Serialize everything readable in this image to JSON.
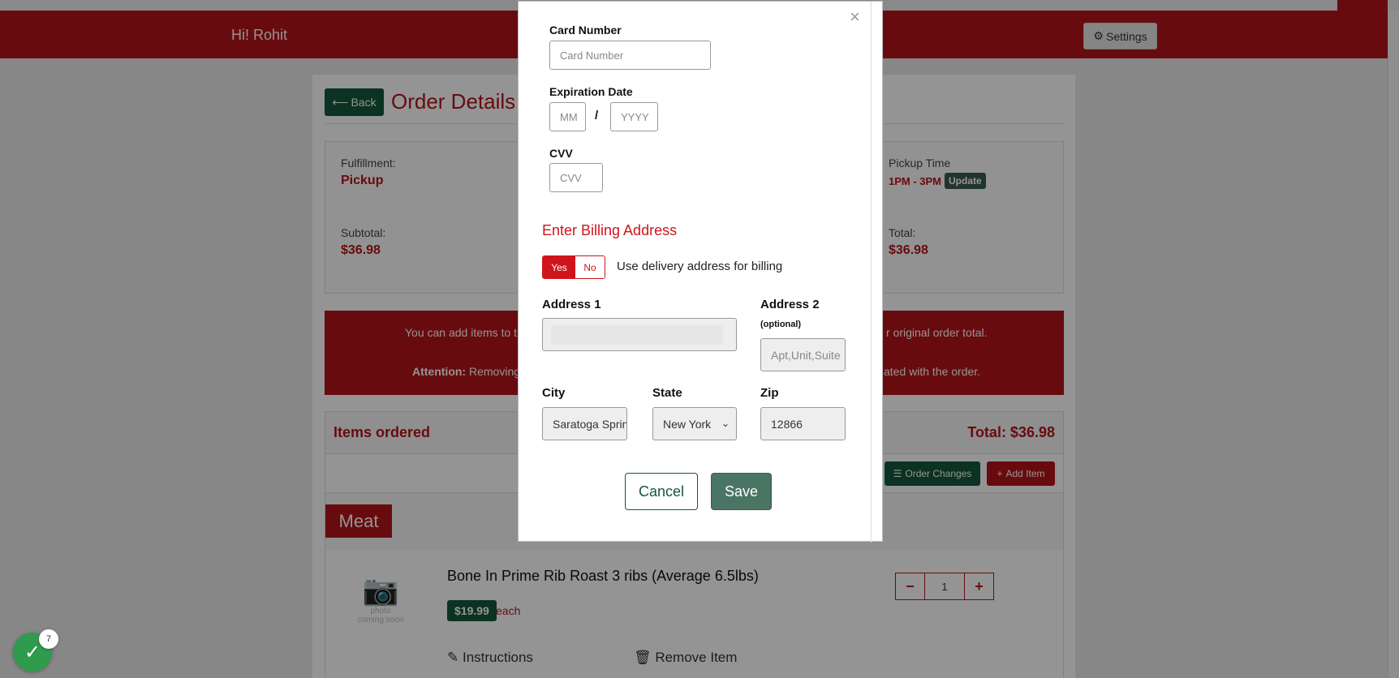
{
  "header": {
    "greeting": "Hi! Rohit",
    "settings_label": "Settings"
  },
  "order": {
    "back_label": "Back",
    "title": "Order Details",
    "fulfillment_label": "Fulfillment:",
    "fulfillment_value": "Pickup",
    "pickup_time_label": "Pickup Time",
    "pickup_time_value": "1PM - 3PM",
    "update_label": "Update",
    "subtotal_label": "Subtotal:",
    "subtotal_value": "$36.98",
    "total_label": "Total:",
    "total_value": "$36.98"
  },
  "notice": {
    "line1_left": "You can add items to th",
    "line1_right": "r original order total.",
    "line2_bold": "Attention:",
    "line2_left": " Removing",
    "line2_right": "ated with the order."
  },
  "items": {
    "title": "Items ordered",
    "total": "Total: $36.98",
    "order_changes_label": "Order Changes",
    "add_item_label": "Add Item",
    "category": "Meat",
    "product": {
      "photo_text_1": "photo",
      "photo_text_2": "coming soon",
      "name": "Bone In Prime Rib Roast 3 ribs (Average 6.5lbs)",
      "price": "$19.99",
      "unit": "each",
      "quantity": "1",
      "instructions_label": "Instructions",
      "remove_label": "Remove Item"
    }
  },
  "modal": {
    "close": "×",
    "card_number_label": "Card Number",
    "card_number_placeholder": "Card Number",
    "expiration_label": "Expiration Date",
    "month_placeholder": "MM",
    "slash": "/",
    "year_placeholder": "YYYY",
    "cvv_label": "CVV",
    "cvv_placeholder": "CVV",
    "billing_heading": "Enter Billing Address",
    "toggle_yes": "Yes",
    "toggle_no": "No",
    "toggle_text": "Use delivery address for billing",
    "address1_label": "Address 1",
    "address2_label": "Address 2",
    "address2_optional": "(optional)",
    "address2_placeholder": "Apt,Unit,Suite",
    "city_label": "City",
    "city_value": "Saratoga Springs",
    "state_label": "State",
    "state_value": "New York",
    "zip_label": "Zip",
    "zip_value": "12866",
    "cancel_label": "Cancel",
    "save_label": "Save"
  },
  "chat": {
    "badge_count": "7"
  },
  "colors": {
    "brand_red": "#b3141b",
    "brand_green": "#13573b",
    "save_green": "#4a7565"
  }
}
